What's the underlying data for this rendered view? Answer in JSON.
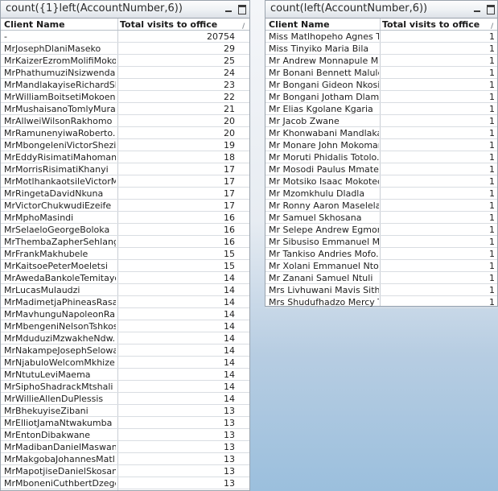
{
  "left_table": {
    "title": "count({1}left(AccountNumber,6))",
    "headers": {
      "client": "Client Name",
      "visits": "Total visits to office"
    },
    "sort_glyph": "/",
    "total_row": {
      "client": "-",
      "visits": "20754"
    },
    "rows": [
      {
        "client": "MrJosephDlaniMaseko",
        "visits": "29"
      },
      {
        "client": "MrKaizerEzromMolifiMoko...",
        "visits": "25"
      },
      {
        "client": "MrPhathumuziNsizwendal...",
        "visits": "24"
      },
      {
        "client": "MrMandlakayiseRichardShezi",
        "visits": "23"
      },
      {
        "client": "MrWilliamBoitsetiMokoena",
        "visits": "22"
      },
      {
        "client": "MrMushaisanoTomlyMuraga",
        "visits": "21"
      },
      {
        "client": "MrAllweiWilsonRakhomo",
        "visits": "20"
      },
      {
        "client": "MrRamunenyiwaRoberto...",
        "visits": "20"
      },
      {
        "client": "MrMbongeleniVictorShezi",
        "visits": "19"
      },
      {
        "client": "MrEddyRisimatiMahomane",
        "visits": "18"
      },
      {
        "client": "MrMorrisRisimatiKhanyi",
        "visits": "17"
      },
      {
        "client": "MrMotlhankaotsileVictorM...",
        "visits": "17"
      },
      {
        "client": "MrRingetaDavidNkuna",
        "visits": "17"
      },
      {
        "client": "MrVictorChukwudiEzeife",
        "visits": "17"
      },
      {
        "client": "MrMphoMasindi",
        "visits": "16"
      },
      {
        "client": "MrSelaeloGeorgeBoloka",
        "visits": "16"
      },
      {
        "client": "MrThembaZapherSehlangu",
        "visits": "16"
      },
      {
        "client": "MrFrankMakhubele",
        "visits": "15"
      },
      {
        "client": "MrKaitsoePeterMoeletsi",
        "visits": "15"
      },
      {
        "client": "MrAwedaBankoleTemitayo",
        "visits": "14"
      },
      {
        "client": "MrLucasMulaudzi",
        "visits": "14"
      },
      {
        "client": "MrMadimetjaPhineasRasa...",
        "visits": "14"
      },
      {
        "client": "MrMavhunguNapoleonRa...",
        "visits": "14"
      },
      {
        "client": "MrMbengeniNelsonTshkosi",
        "visits": "14"
      },
      {
        "client": "MrMduduziMzwakheNdw...",
        "visits": "14"
      },
      {
        "client": "MrNakampeJosephSelowa",
        "visits": "14"
      },
      {
        "client": "MrNjabuloWelcomMkhize",
        "visits": "14"
      },
      {
        "client": "MrNtutuLeviMaema",
        "visits": "14"
      },
      {
        "client": "MrSiphoShadrackMtshali",
        "visits": "14"
      },
      {
        "client": "MrWillieAllenDuPlessis",
        "visits": "14"
      },
      {
        "client": "MrBhekuyiseZibani",
        "visits": "13"
      },
      {
        "client": "MrElliotJamaNtwakumba",
        "visits": "13"
      },
      {
        "client": "MrEntonDibakwane",
        "visits": "13"
      },
      {
        "client": "MrMadibanDanielMaswan...",
        "visits": "13"
      },
      {
        "client": "MrMakgobaJohannesMatl...",
        "visits": "13"
      },
      {
        "client": "MrMapotjiseDanielSkosana",
        "visits": "13"
      },
      {
        "client": "MrMboneniCuthbertDzege",
        "visits": "13"
      }
    ]
  },
  "right_table": {
    "title": "count(left(AccountNumber,6))",
    "headers": {
      "client": "Client Name",
      "visits": "Total visits to office"
    },
    "sort_glyph": "/",
    "rows": [
      {
        "client": "Miss Matlhopeho Agnes T...",
        "visits": "1"
      },
      {
        "client": "Miss Tinyiko Maria Bila",
        "visits": "1"
      },
      {
        "client": "Mr Andrew Monnapule Ma...",
        "visits": "1"
      },
      {
        "client": "Mr Bonani Bennett Maluleka",
        "visits": "1"
      },
      {
        "client": "Mr Bongani Gideon Nkosi",
        "visits": "1"
      },
      {
        "client": "Mr Bongani Jotham Dlamini",
        "visits": "1"
      },
      {
        "client": "Mr Elias Kgolane Kgaria",
        "visits": "1"
      },
      {
        "client": "Mr Jacob Zwane",
        "visits": "1"
      },
      {
        "client": "Mr Khonwabani Mandlaka...",
        "visits": "1"
      },
      {
        "client": "Mr Monare John Mokomane",
        "visits": "1"
      },
      {
        "client": "Mr Moruti Phidalis Totolo...",
        "visits": "1"
      },
      {
        "client": "Mr Mosodi Paulus Mmatema",
        "visits": "1"
      },
      {
        "client": "Mr Motsiko Isaac Mokotedi",
        "visits": "1"
      },
      {
        "client": "Mr Mzomkhulu Dladla",
        "visits": "1"
      },
      {
        "client": "Mr Ronny Aaron Maselela",
        "visits": "1"
      },
      {
        "client": "Mr Samuel Skhosana",
        "visits": "1"
      },
      {
        "client": "Mr Selepe Andrew Egmond",
        "visits": "1"
      },
      {
        "client": "Mr Sibusiso Emmanuel M...",
        "visits": "1"
      },
      {
        "client": "Mr Tankiso Andries Mofo...",
        "visits": "1"
      },
      {
        "client": "Mr Xolani Emmanuel Nto...",
        "visits": "1"
      },
      {
        "client": "Mr Zanani Samuel Ntuli",
        "visits": "1"
      },
      {
        "client": "Mrs Livhuwani Mavis Sithole",
        "visits": "1"
      },
      {
        "client": "Mrs Shudufhadzo Mercy T...",
        "visits": "1"
      }
    ]
  }
}
